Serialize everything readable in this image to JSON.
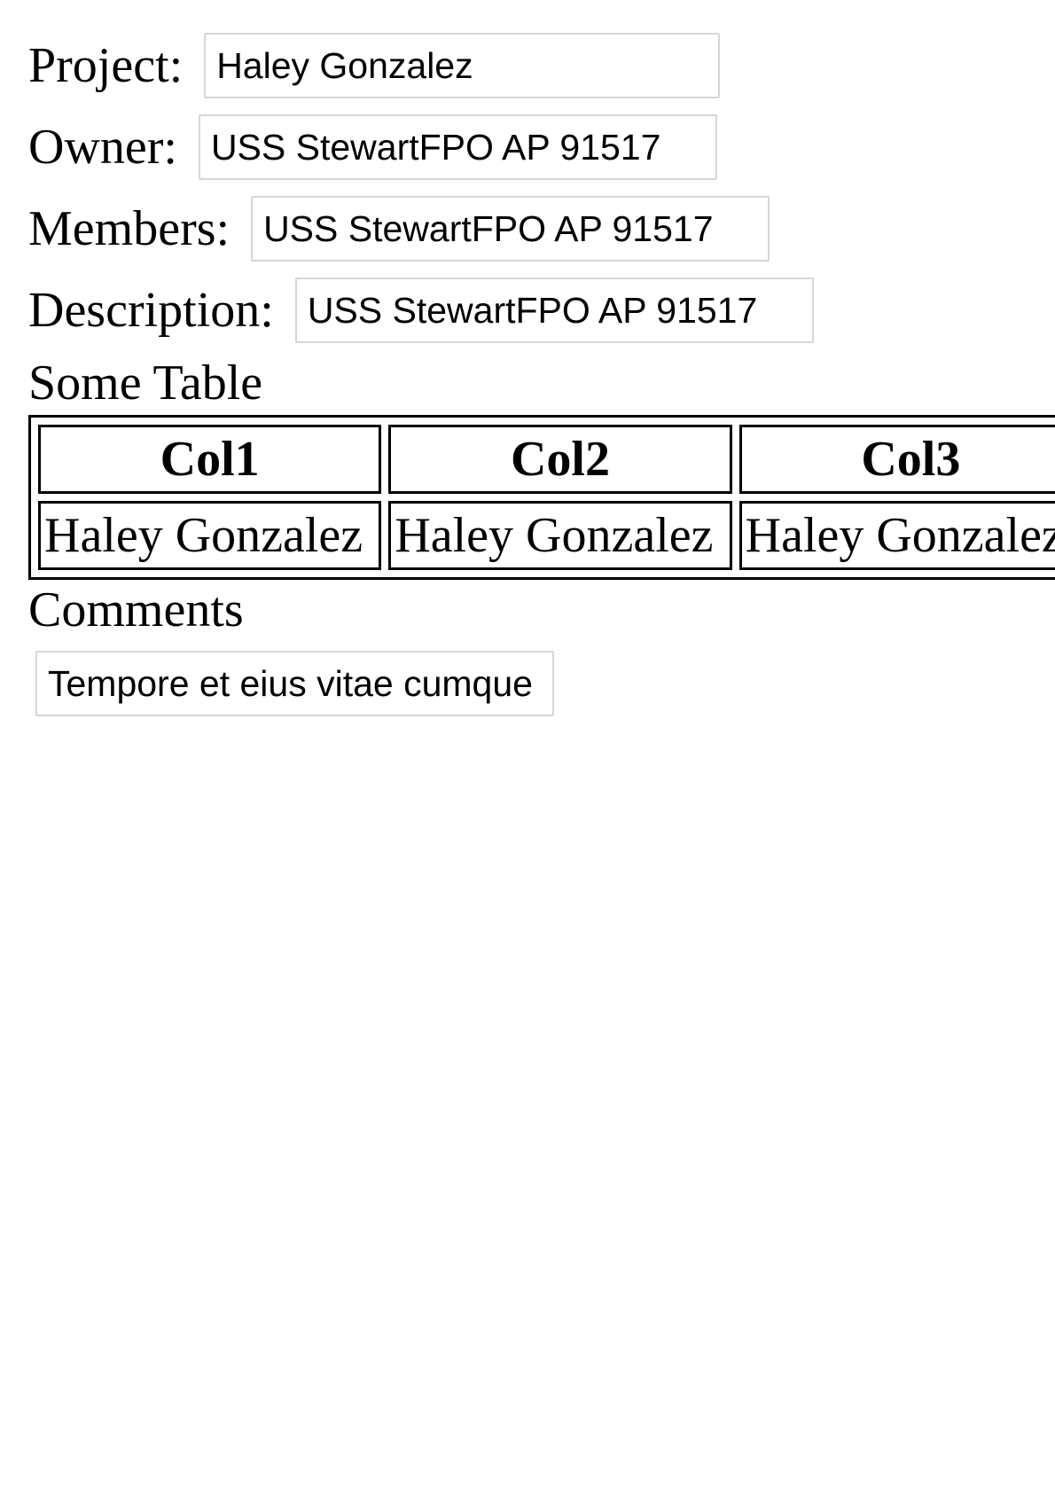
{
  "form": {
    "project": {
      "label": "Project:",
      "value": "Haley Gonzalez"
    },
    "owner": {
      "label": "Owner:",
      "value": "USS StewartFPO AP 91517"
    },
    "members": {
      "label": "Members:",
      "value": "USS StewartFPO AP 91517"
    },
    "description": {
      "label": "Description:",
      "value": "USS StewartFPO AP 91517"
    }
  },
  "table": {
    "heading": "Some Table",
    "columns": [
      "Col1",
      "Col2",
      "Col3"
    ],
    "rows": [
      [
        "Haley Gonzalez",
        "Haley Gonzalez",
        "Haley Gonzalez"
      ]
    ]
  },
  "comments": {
    "heading": "Comments",
    "value": "Tempore et eius vitae cumque"
  }
}
